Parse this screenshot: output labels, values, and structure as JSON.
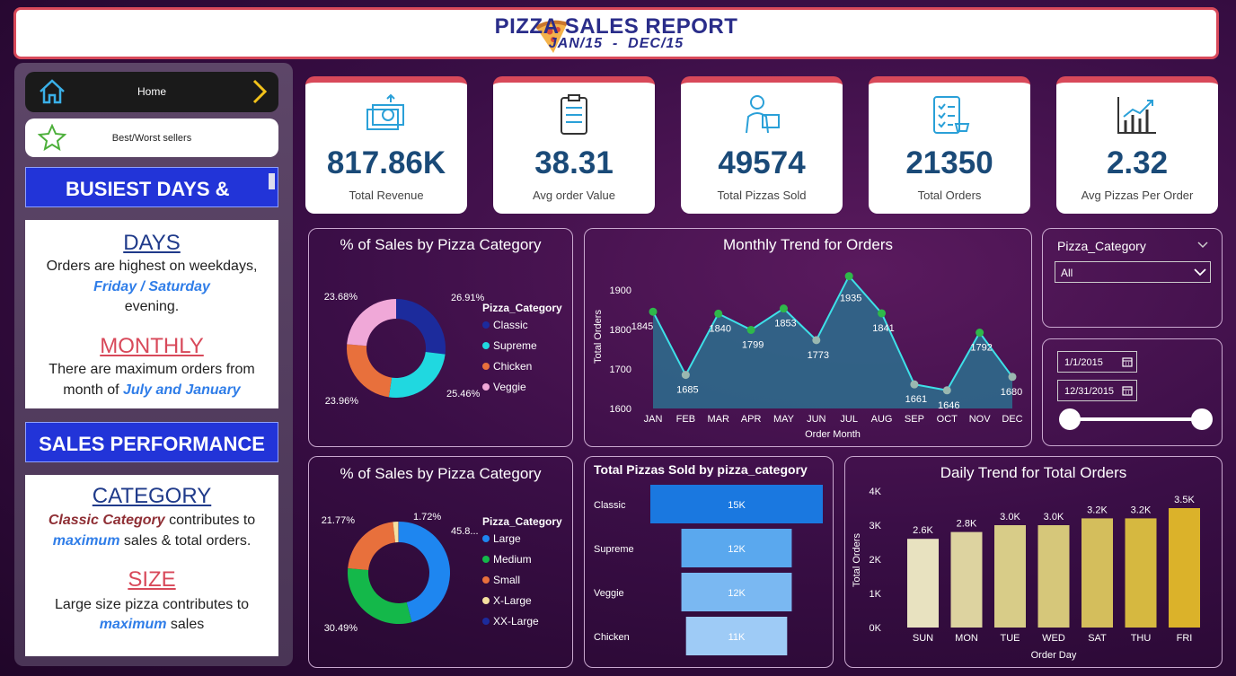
{
  "header": {
    "title": "PIZZA SALES REPORT",
    "subtitle": "JAN/15  -  DEC/15"
  },
  "sidebar": {
    "home_label": "Home",
    "best_label": "Best/Worst sellers",
    "busiest_banner": "BUSIEST DAYS &",
    "sales_banner": "SALES PERFORMANCE",
    "days": {
      "heading": "DAYS",
      "line1": "Orders are highest on weekdays,",
      "line2": "Friday / Saturday",
      "line3": "evening."
    },
    "monthly": {
      "heading": "MONTHLY",
      "line1": "There are maximum orders from",
      "line2_pre": "month of ",
      "line2_hl": "July and January"
    },
    "category": {
      "heading": "CATEGORY",
      "line1_hl": "Classic Category",
      "line1_rest": " contributes to",
      "line2_hl": "maximum",
      "line2_rest": " sales & total orders."
    },
    "size": {
      "heading": "SIZE",
      "line1": "Large size pizza contributes to",
      "line2_hl": "maximum",
      "line2_rest": " sales"
    }
  },
  "kpis": [
    {
      "value": "817.86K",
      "label": "Total Revenue",
      "icon": "money-icon"
    },
    {
      "value": "38.31",
      "label": "Avg order Value",
      "icon": "clipboard-icon"
    },
    {
      "value": "49574",
      "label": "Total Pizzas Sold",
      "icon": "delivery-person-icon"
    },
    {
      "value": "21350",
      "label": "Total Orders",
      "icon": "order-list-icon"
    },
    {
      "value": "2.32",
      "label": "Avg Pizzas Per Order",
      "icon": "growth-chart-icon"
    }
  ],
  "filters": {
    "category_label": "Pizza_Category",
    "category_value": "All",
    "date_start": "1/1/2015",
    "date_end": "12/31/2015"
  },
  "colors": {
    "accent": "#d8495a",
    "banner_blue": "#2234d8",
    "kpi_value": "#1a4a78",
    "title_navy": "#2a2d8a"
  },
  "chart_data": [
    {
      "type": "pie",
      "title": "% of Sales by Pizza Category",
      "legend_title": "Pizza_Category",
      "categories": [
        "Classic",
        "Supreme",
        "Chicken",
        "Veggie"
      ],
      "values": [
        26.91,
        25.46,
        23.96,
        23.68
      ],
      "labels": [
        "26.91%",
        "25.46%",
        "23.96%",
        "23.68%"
      ],
      "colors": [
        "#1c2b9c",
        "#20d8e0",
        "#e8703c",
        "#f0a8d8"
      ]
    },
    {
      "type": "line",
      "title": "Monthly Trend for Orders",
      "xlabel": "Order Month",
      "ylabel": "Total Orders",
      "categories": [
        "JAN",
        "FEB",
        "MAR",
        "APR",
        "MAY",
        "JUN",
        "JUL",
        "AUG",
        "SEP",
        "OCT",
        "NOV",
        "DEC"
      ],
      "values": [
        1845,
        1685,
        1840,
        1799,
        1853,
        1773,
        1935,
        1841,
        1661,
        1646,
        1792,
        1680
      ],
      "yticks": [
        1600,
        1700,
        1800,
        1900
      ],
      "ylim": [
        1600,
        1950
      ]
    },
    {
      "type": "pie",
      "title": "% of Sales by Pizza Category",
      "legend_title": "Pizza_Category",
      "categories": [
        "Large",
        "Medium",
        "Small",
        "X-Large",
        "XX-Large"
      ],
      "values": [
        45.89,
        30.49,
        21.77,
        1.72,
        0.12
      ],
      "labels": [
        "45.8...",
        "30.49%",
        "21.77%",
        "1.72%",
        ""
      ],
      "colors": [
        "#1e86f0",
        "#14b84a",
        "#e8703c",
        "#f5e0a0",
        "#1c2b9c"
      ]
    },
    {
      "type": "bar",
      "title": "Total Pizzas Sold by pizza_category",
      "categories": [
        "Classic",
        "Supreme",
        "Veggie",
        "Chicken"
      ],
      "values": [
        15000,
        12000,
        12000,
        11000
      ],
      "labels": [
        "15K",
        "12K",
        "12K",
        "11K"
      ],
      "colors": [
        "#1a78e0",
        "#5aa8ee",
        "#7ab8f2",
        "#9ecbf6"
      ]
    },
    {
      "type": "bar",
      "title": "Daily Trend for Total Orders",
      "xlabel": "Order Day",
      "ylabel": "Total Orders",
      "categories": [
        "SUN",
        "MON",
        "TUE",
        "WED",
        "SAT",
        "THU",
        "FRI"
      ],
      "values": [
        2600,
        2800,
        3000,
        3000,
        3200,
        3200,
        3500
      ],
      "labels": [
        "2.6K",
        "2.8K",
        "3.0K",
        "3.0K",
        "3.2K",
        "3.2K",
        "3.5K"
      ],
      "yticks": [
        "0K",
        "1K",
        "2K",
        "3K",
        "4K"
      ],
      "ylim": [
        0,
        4000
      ],
      "colors": [
        "#e8e2c0",
        "#ddd3a0",
        "#d8cc88",
        "#d6c77a",
        "#d4be5c",
        "#d6b840",
        "#dbb22a"
      ]
    }
  ]
}
